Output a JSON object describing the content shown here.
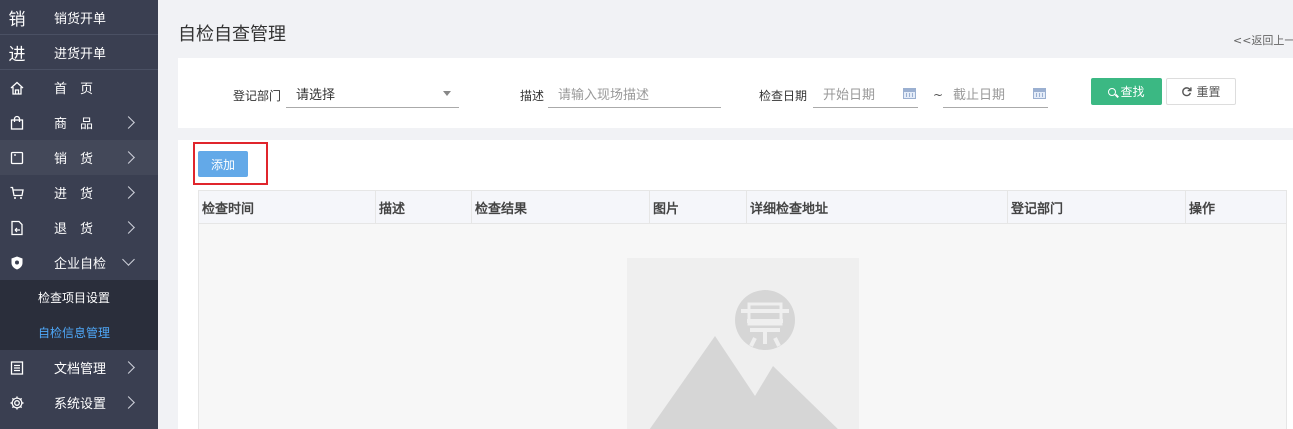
{
  "sidebar": {
    "quick": [
      {
        "glyph": "销",
        "label": "销货开单"
      },
      {
        "glyph": "进",
        "label": "进货开单"
      }
    ],
    "items": [
      {
        "icon": "home-icon",
        "label": "首　页",
        "arrow": false
      },
      {
        "icon": "bag-icon",
        "label": "商　品",
        "arrow": true
      },
      {
        "icon": "sales-icon",
        "label": "销　货",
        "arrow": true
      },
      {
        "icon": "cart-icon",
        "label": "进　货",
        "arrow": true
      },
      {
        "icon": "return-icon",
        "label": "退　货",
        "arrow": true
      },
      {
        "icon": "shield-icon",
        "label": "企业自检",
        "arrow": true,
        "expanded": true
      }
    ],
    "sub_items": [
      {
        "label": "检查项目设置",
        "active": false
      },
      {
        "label": "自检信息管理",
        "active": true
      }
    ],
    "bottom_items": [
      {
        "icon": "document-icon",
        "label": "文档管理"
      },
      {
        "icon": "gear-icon",
        "label": "系统设置"
      }
    ]
  },
  "header": {
    "title": "自检自查管理",
    "back_link": "<<返回上一"
  },
  "filters": {
    "dept_label": "登记部门",
    "dept_value": "请选择",
    "desc_label": "描述",
    "desc_placeholder": "请输入现场描述",
    "date_label": "检查日期",
    "start_placeholder": "开始日期",
    "range_sep": "~",
    "end_placeholder": "截止日期",
    "search_label": "查找",
    "reset_label": "重置"
  },
  "toolbar": {
    "add_label": "添加"
  },
  "table": {
    "columns": [
      "检查时间",
      "描述",
      "检查结果",
      "图片",
      "详细检查地址",
      "登记部门",
      "操作"
    ],
    "rows": []
  },
  "colors": {
    "sidebar_bg": "#3a3f51",
    "submenu_bg": "#2a2e3b",
    "active_sub": "#4fa8f8",
    "search_btn": "#3bb883",
    "add_btn": "#63a9e8",
    "highlight_border": "#e0252c"
  }
}
